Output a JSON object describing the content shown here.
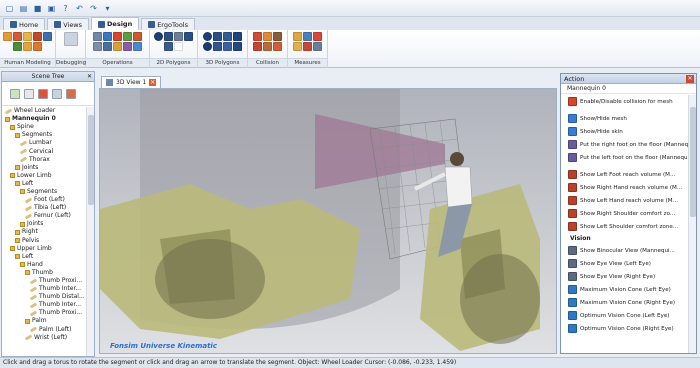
{
  "ribbon": {
    "tabs": [
      {
        "label": "Home",
        "active": false
      },
      {
        "label": "Views",
        "active": false
      },
      {
        "label": "Design",
        "active": true
      },
      {
        "label": "ErgoTools",
        "active": false
      }
    ],
    "groups": [
      {
        "label": "Human Modeling"
      },
      {
        "label": "Debugging"
      },
      {
        "label": "Operations"
      },
      {
        "label": "2D Polygons"
      },
      {
        "label": "3D Polygons"
      },
      {
        "label": "Collision"
      },
      {
        "label": "Measures"
      }
    ]
  },
  "scene_tree": {
    "title": "Scene Tree",
    "items": [
      {
        "label": "Wheel Loader"
      },
      {
        "label": "Mannequin 0"
      },
      {
        "label": "Spine"
      },
      {
        "label": "Segments"
      },
      {
        "label": "Lumbar"
      },
      {
        "label": "Cervical"
      },
      {
        "label": "Thorax"
      },
      {
        "label": "Joints"
      },
      {
        "label": "Lower Limb"
      },
      {
        "label": "Left"
      },
      {
        "label": "Segments"
      },
      {
        "label": "Foot (Left)"
      },
      {
        "label": "Tibia (Left)"
      },
      {
        "label": "Femur (Left)"
      },
      {
        "label": "Joints"
      },
      {
        "label": "Right"
      },
      {
        "label": "Pelvis"
      },
      {
        "label": "Upper Limb"
      },
      {
        "label": "Left"
      },
      {
        "label": "Hand"
      },
      {
        "label": "Thumb"
      },
      {
        "label": "Thumb Proxi..."
      },
      {
        "label": "Thumb Inter..."
      },
      {
        "label": "Thumb Distal..."
      },
      {
        "label": "Thumb Inter..."
      },
      {
        "label": "Thumb Proxi..."
      },
      {
        "label": "Palm"
      },
      {
        "label": "Palm (Left)"
      },
      {
        "label": "Wrist (Left)"
      }
    ]
  },
  "view": {
    "tab_label": "3D View 1",
    "watermark": "Fonsim Universe Kinematic"
  },
  "action_panel": {
    "title": "Action",
    "subtitle": "Mannequin 0",
    "items": [
      {
        "label": "Enable/Disable collision for mesh",
        "color": "#d6452b"
      },
      {
        "sep": true
      },
      {
        "label": "Show/Hide mesh",
        "color": "#3a7bd5"
      },
      {
        "label": "Show/Hide skin",
        "color": "#3a7bd5"
      },
      {
        "label": "Put the right foot on the floor (Mannequin 0)",
        "color": "#6a5a9e"
      },
      {
        "label": "Put the left foot on the floor (Mannequin 0)",
        "color": "#6a5a9e"
      },
      {
        "sep": true
      },
      {
        "label": "Show Left Foot reach volume (M...",
        "color": "#b8422a"
      },
      {
        "label": "Show Right Hand reach volume (M...",
        "color": "#b8422a"
      },
      {
        "label": "Show Left Hand reach volume (M...",
        "color": "#b8422a"
      },
      {
        "label": "Show Right Shoulder comfort zo...",
        "color": "#b8422a"
      },
      {
        "label": "Show Left Shoulder comfort zone...",
        "color": "#b8422a"
      },
      {
        "section": "Vision"
      },
      {
        "label": "Show Binocular View (Mannequi...",
        "color": "#5b6b80"
      },
      {
        "label": "Show Eye View (Left Eye)",
        "color": "#5b6b80"
      },
      {
        "label": "Show Eye View (Right Eye)",
        "color": "#5b6b80"
      },
      {
        "label": "Maximum Vision Cone (Left Eye)",
        "color": "#2f79c4"
      },
      {
        "label": "Maximum Vision Cone (Right Eye)",
        "color": "#2f79c4"
      },
      {
        "label": "Optimum Vision Cone (Left Eye)",
        "color": "#2f79c4"
      },
      {
        "label": "Optimum Vision Cone (Right Eye)",
        "color": "#2f79c4"
      }
    ]
  },
  "status_text": "Click and drag a torus to rotate the segment or click and drag an arrow to translate the segment. Object: Wheel Loader Cursor: (-0.086, -0.233, 1.459)",
  "colors": {
    "accent": "#2f5f9e",
    "loader": "#b9b97a",
    "vision_cone": "#a07a96"
  }
}
